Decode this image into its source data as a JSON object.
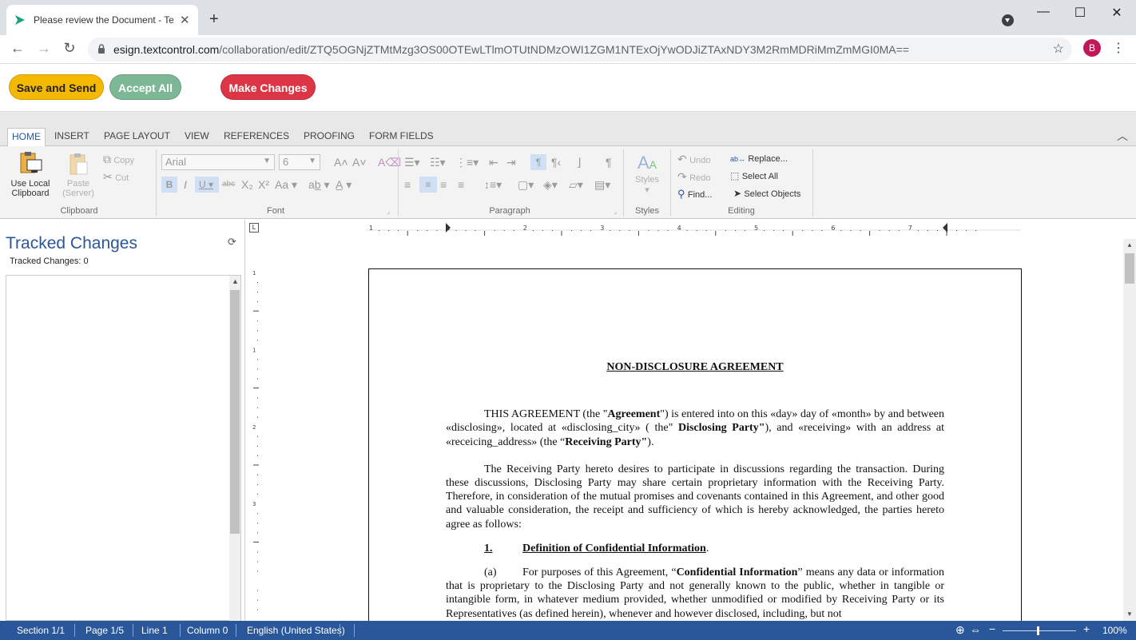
{
  "browser": {
    "tab_title": "Please review the Document - Te",
    "url_host": "esign.textcontrol.com",
    "url_path": "/collaboration/edit/ZTQ5OGNjZTMtMzg3OS00OTEwLTlmOTUtNDMzOWI1ZGM1NTExOjYwODJiZTAxNDY3M2RmMDRiMmZmMGI0MA==",
    "avatar_letter": "B"
  },
  "actions": {
    "save_send": "Save and Send",
    "accept_all": "Accept All",
    "make_changes": "Make Changes",
    "colors": {
      "save_send": "#f5b800",
      "accept_all": "#7db896",
      "make_changes": "#dc3545"
    }
  },
  "ribbon": {
    "tabs": [
      "HOME",
      "INSERT",
      "PAGE LAYOUT",
      "VIEW",
      "REFERENCES",
      "PROOFING",
      "FORM FIELDS"
    ],
    "clipboard": {
      "use_local_l1": "Use Local",
      "use_local_l2": "Clipboard",
      "paste_l1": "Paste",
      "paste_l2": "(Server)",
      "copy": "Copy",
      "cut": "Cut",
      "group": "Clipboard"
    },
    "font": {
      "family": "Arial",
      "size": "6",
      "group": "Font"
    },
    "paragraph": {
      "group": "Paragraph"
    },
    "styles": {
      "label": "Styles",
      "group": "Styles"
    },
    "editing": {
      "undo": "Undo",
      "redo": "Redo",
      "find": "Find...",
      "replace": "Replace...",
      "select_all": "Select All",
      "select_objects": "Select Objects",
      "group": "Editing"
    }
  },
  "tracked": {
    "title": "Tracked Changes",
    "count_label": "Tracked Changes: 0"
  },
  "ruler": {
    "h_numbers": [
      "1",
      "1",
      "2",
      "3",
      "4",
      "5",
      "6",
      "7"
    ],
    "v_numbers": [
      "1",
      "1",
      "2",
      "3"
    ]
  },
  "document": {
    "heading": "NON-DISCLOSURE AGREEMENT",
    "p1_a": "THIS AGREEMENT (the \"",
    "p1_b": "Agreement",
    "p1_c": "\") is entered into on this «day» day of «month» by and between «disclosing», located at «disclosing_city» ( the\"",
    "p1_d": "Disclosing Party\"",
    "p1_e": "), and «receiving» with an address at «receicing_address» (the “",
    "p1_f": "Receiving Party\"",
    "p1_g": ").",
    "p2": "The Receiving Party hereto desires to participate in discussions regarding the transaction. During these discussions, Disclosing Party may share certain proprietary information with the Receiving Party.  Therefore, in consideration of the mutual promises and covenants contained in this Agreement, and other good and valuable consideration, the receipt and sufficiency of which is hereby acknowledged, the parties hereto agree as follows:",
    "s1_num": "1.",
    "s1_title": "Definition of Confidential Information",
    "s1_dot": ".",
    "a_label": "(a)",
    "a_text1": "For purposes of this Agreement, “",
    "a_bold": "Confidential Information",
    "a_text2": "” means any data or information that is proprietary to the Disclosing Party and not generally known to the public, whether in tangible or intangible form, in whatever medium provided, whether unmodified or modified by Receiving Party or its Representatives (as defined herein), whenever and however disclosed, including, but not"
  },
  "status": {
    "section": "Section 1/1",
    "page": "Page 1/5",
    "line": "Line 1",
    "column": "Column 0",
    "language": "English (United States)",
    "zoom": "100%",
    "bar_color": "#2a579a"
  }
}
